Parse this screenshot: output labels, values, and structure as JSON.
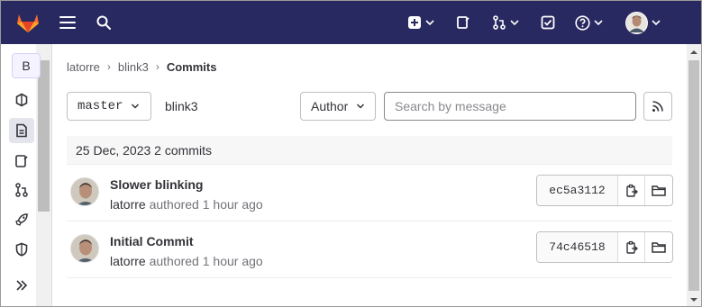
{
  "breadcrumb": {
    "items": [
      "latorre",
      "blink3"
    ],
    "current": "Commits"
  },
  "sidebar": {
    "project_initial": "B"
  },
  "filters": {
    "branch": "master",
    "project": "blink3",
    "author_label": "Author",
    "search_placeholder": "Search by message"
  },
  "commits": {
    "day_header": "25 Dec, 2023 2 commits",
    "items": [
      {
        "title": "Slower blinking",
        "author": "latorre",
        "meta": "authored 1 hour ago",
        "sha": "ec5a3112"
      },
      {
        "title": "Initial Commit",
        "author": "latorre",
        "meta": "authored 1 hour ago",
        "sha": "74c46518"
      }
    ]
  },
  "colors": {
    "topbar": "#292961",
    "brand_orange": "#e24329",
    "text": "#333238",
    "muted": "#737278"
  }
}
